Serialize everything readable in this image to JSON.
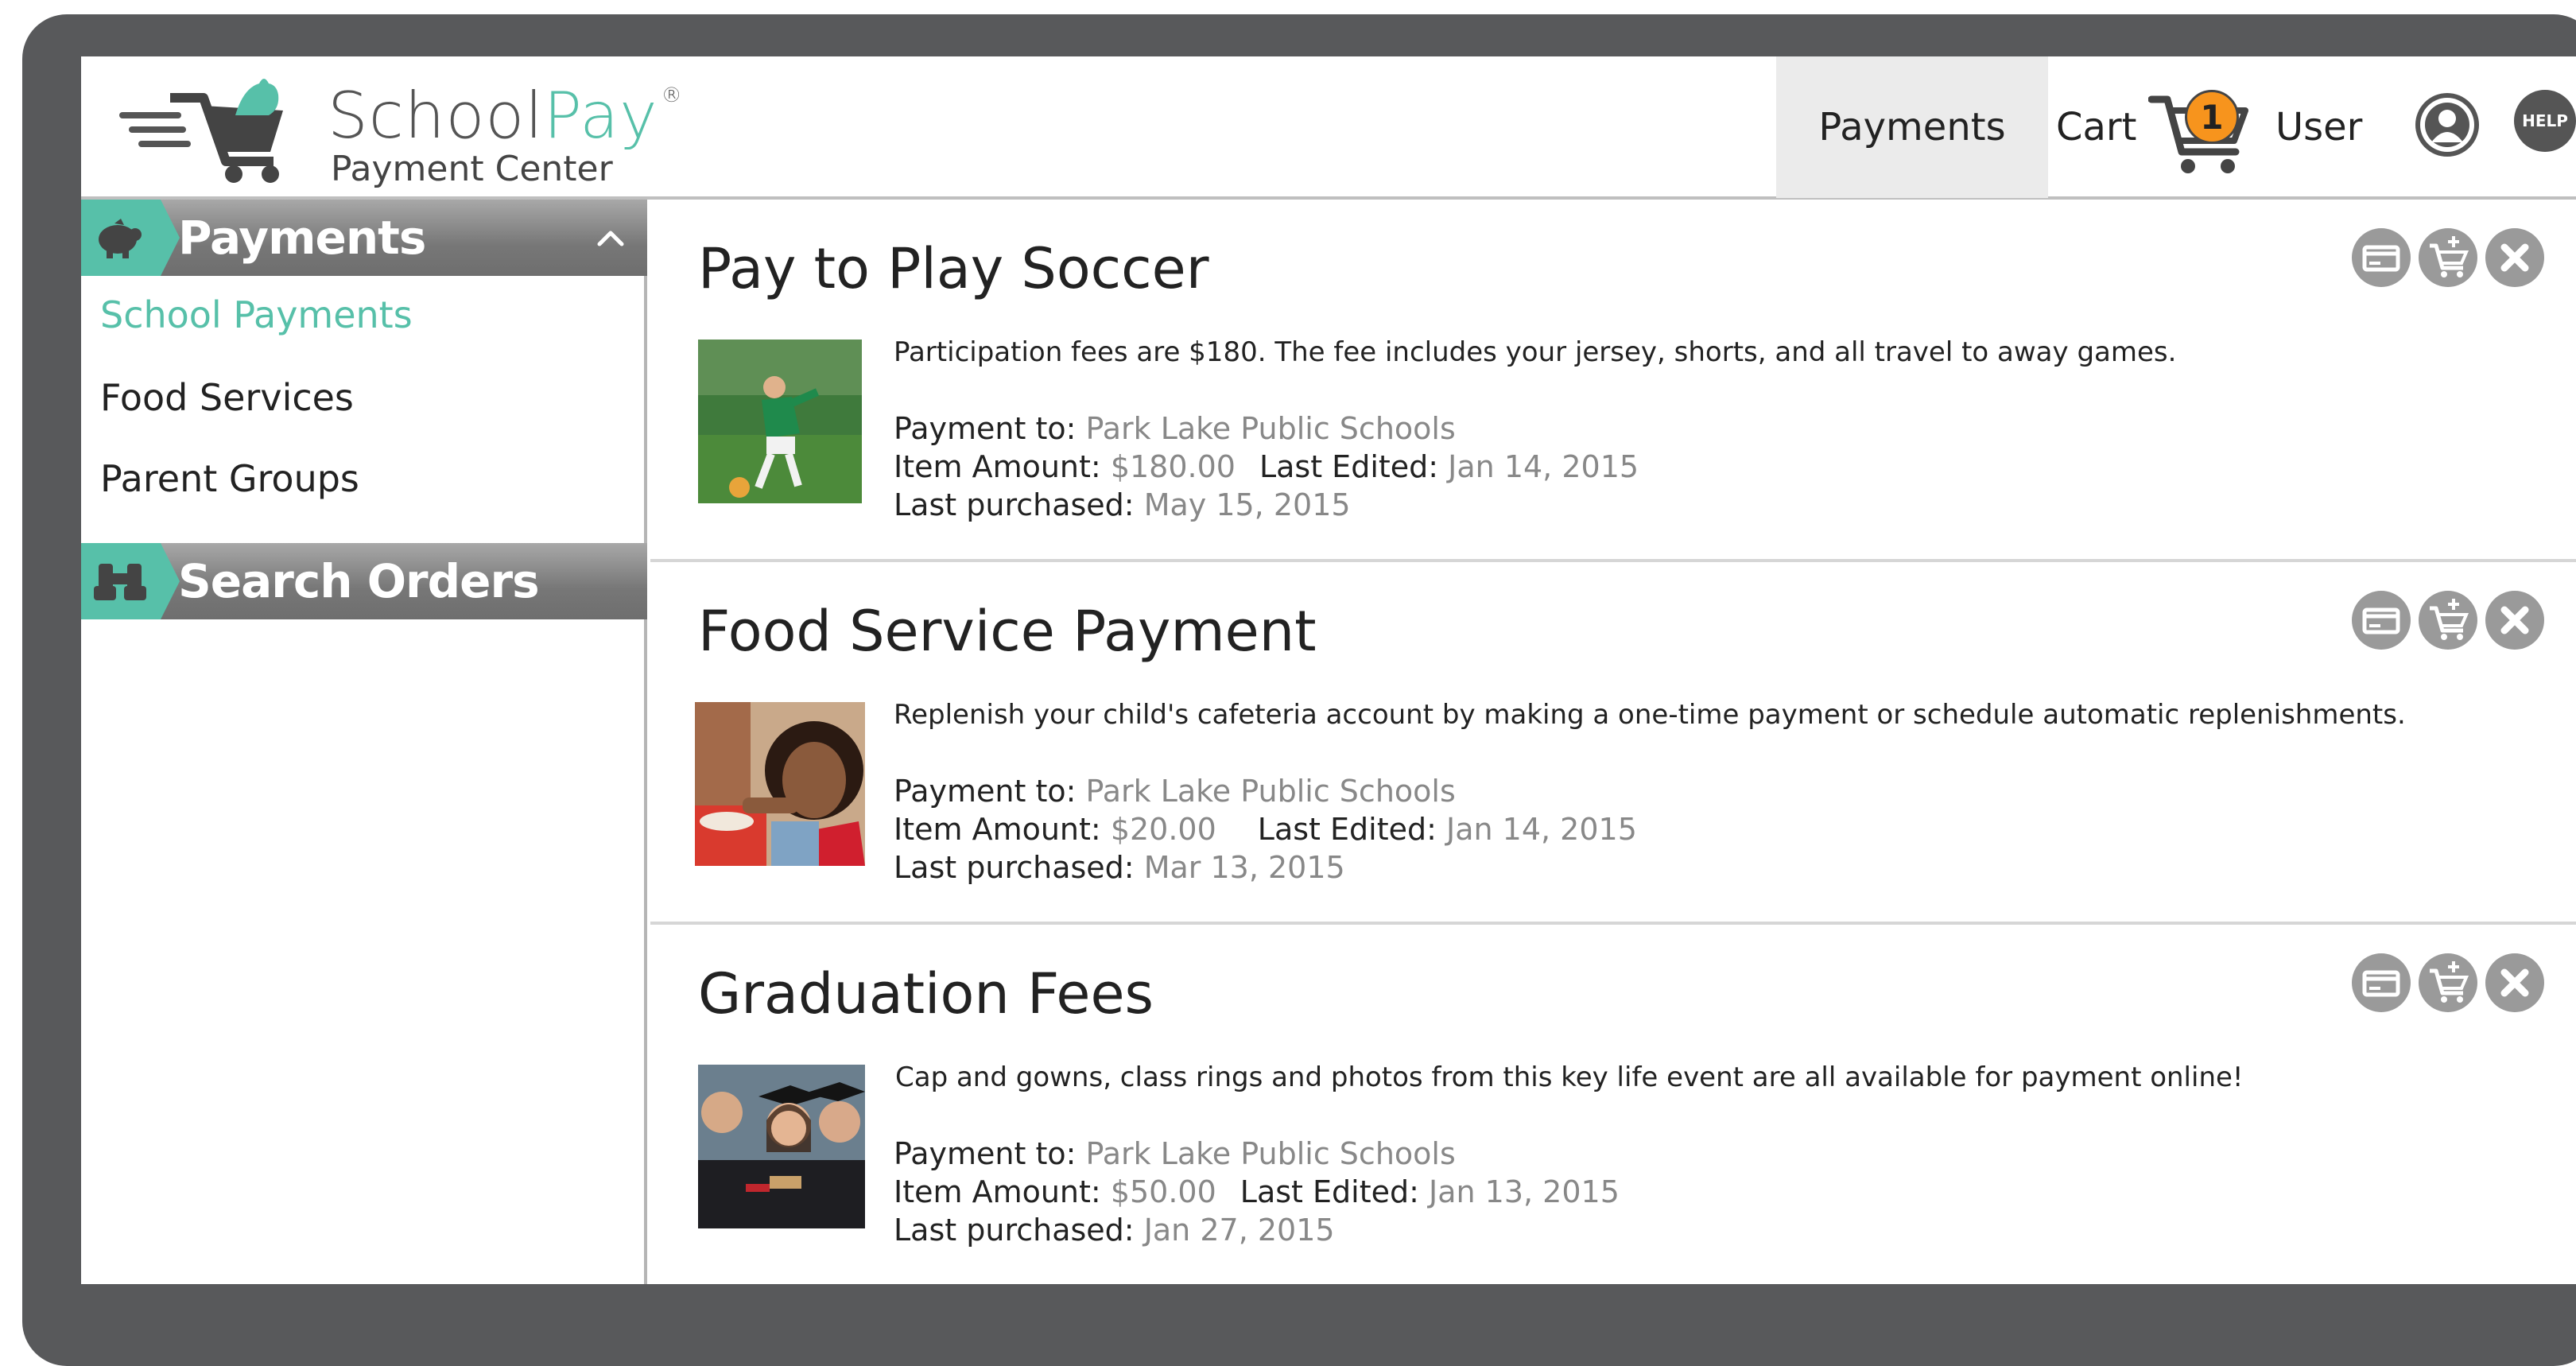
{
  "brand": {
    "name_part1": "School",
    "name_part2": "Pay",
    "registered": "®",
    "subtitle": "Payment Center",
    "accent_color": "#57c0a9"
  },
  "nav": {
    "payments_label": "Payments",
    "cart_label": "Cart",
    "cart_count": "1",
    "user_label": "User",
    "help_label": "HELP"
  },
  "sidebar": {
    "payments_header": "Payments",
    "items": [
      {
        "label": "School Payments",
        "active": true
      },
      {
        "label": "Food Services",
        "active": false
      },
      {
        "label": "Parent Groups",
        "active": false
      }
    ],
    "search_header": "Search Orders"
  },
  "labels": {
    "payment_to": "Payment to:",
    "item_amount": "Item Amount:",
    "last_edited": "Last Edited:",
    "last_purchased": "Last purchased:"
  },
  "items": [
    {
      "title": "Pay to Play Soccer",
      "description": "Participation fees are $180. The fee includes your jersey, shorts, and all travel to away games.",
      "payment_to": "Park Lake Public Schools",
      "amount": "$180.00",
      "last_edited": "Jan 14, 2015",
      "last_purchased": "May 15, 2015"
    },
    {
      "title": "Food Service Payment",
      "description": "Replenish your child's cafeteria account by making a one-time payment or schedule automatic replenishments.",
      "payment_to": "Park Lake Public Schools",
      "amount": "$20.00",
      "last_edited": "Jan 14, 2015",
      "last_purchased": "Mar 13, 2015"
    },
    {
      "title": "Graduation Fees",
      "description": "Cap and gowns, class rings and photos from this key life event are all available for payment online!",
      "payment_to": "Park Lake Public Schools",
      "amount": "$50.00",
      "last_edited": "Jan 13, 2015",
      "last_purchased": "Jan 27, 2015"
    }
  ]
}
